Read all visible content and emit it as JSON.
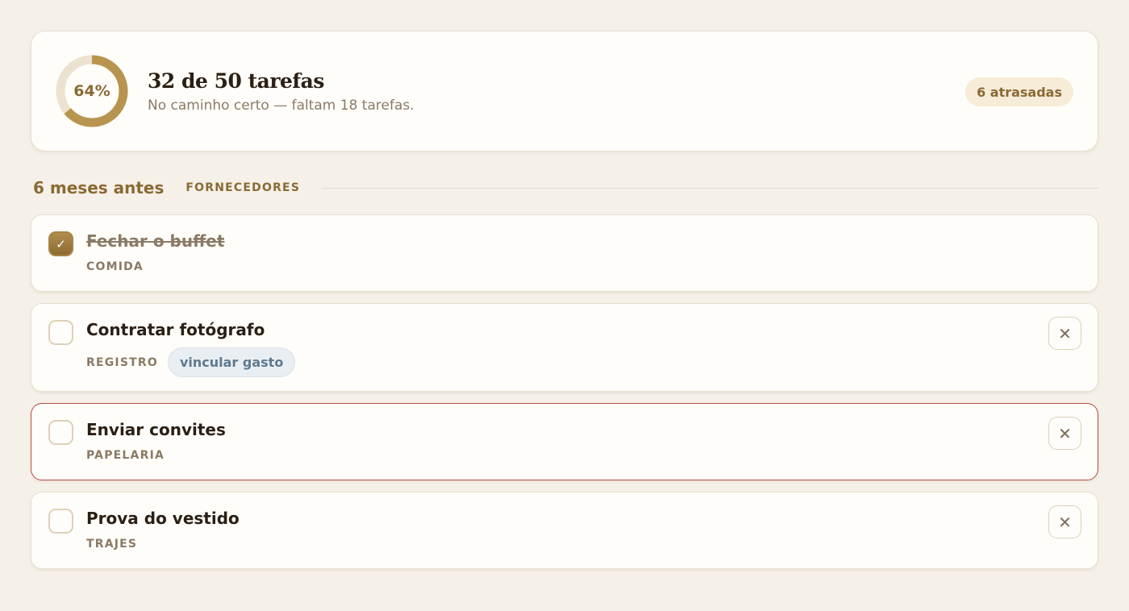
{
  "summary": {
    "percent_label": "64%",
    "progress_fraction": 0.64,
    "title": "32 de 50 tarefas",
    "subtitle": "No caminho certo — faltam 18 tarefas.",
    "late_badge": "6 atrasadas"
  },
  "section": {
    "title": "6 meses antes",
    "tag": "FORNECEDORES"
  },
  "tasks": [
    {
      "title": "Fechar o buffet",
      "category": "COMIDA",
      "done": true,
      "check_glyph": "✓"
    },
    {
      "title": "Contratar fotógrafo",
      "category": "REGISTRO",
      "link_label": "vincular gasto",
      "done": false,
      "remove_glyph": "✕"
    },
    {
      "title": "Enviar convites",
      "category": "PAPELARIA",
      "done": false,
      "late": true,
      "remove_glyph": "✕"
    },
    {
      "title": "Prova do vestido",
      "category": "TRAJES",
      "done": false,
      "remove_glyph": "✕"
    }
  ],
  "colors": {
    "accent": "#8a6a34",
    "ring_fill": "#b8944f",
    "ring_track": "#ece2d0",
    "late_border": "#b34f3e",
    "background": "#f6f1e8"
  },
  "icons": {
    "check": "check-icon",
    "remove": "close-icon"
  }
}
